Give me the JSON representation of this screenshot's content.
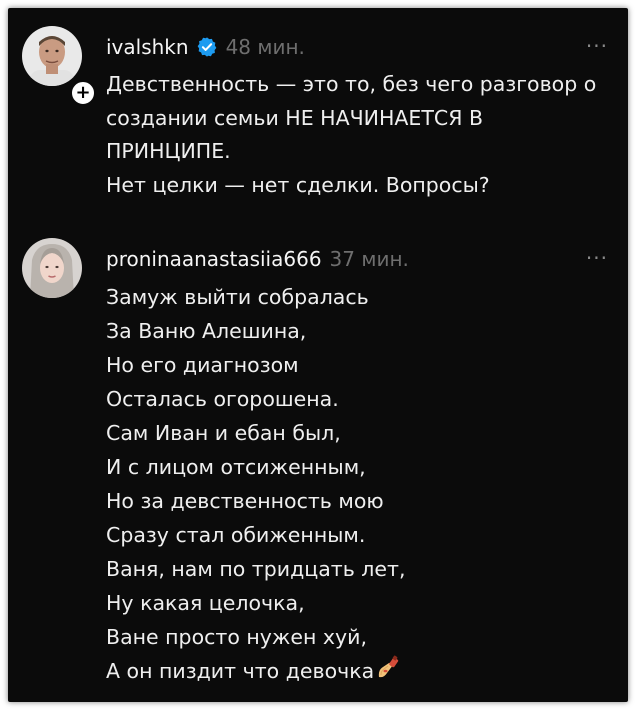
{
  "posts": [
    {
      "username": "ivalshkn",
      "verified": true,
      "time": "48 мин.",
      "more_label": "···",
      "follow_label": "+",
      "lines": [
        "Девственность — это то, без чего разговор о",
        "создании семьи НЕ НАЧИНАЕТСЯ В",
        "ПРИНЦИПЕ.",
        "Нет целки — нет сделки. Вопросы?"
      ]
    },
    {
      "username": "proninaanastasiia666",
      "verified": false,
      "time": "37 мин.",
      "more_label": "···",
      "lines": [
        "Замуж выйти собралась",
        "За Ваню Алешина,",
        "Но его диагнозом",
        "Осталась огорошена.",
        "Сам Иван и ебан был,",
        "И с лицом отсиженным,",
        "Но за девственность мою",
        "Сразу стал обиженным.",
        "Ваня, нам по тридцать лет,",
        "Ну какая целочка,",
        "Ване просто нужен хуй,",
        "А он пиздит что девочка"
      ],
      "trailing_icon": "nail-polish-icon"
    }
  ],
  "colors": {
    "background": "#0b0b0b",
    "text": "#efefef",
    "muted": "#6e6e6e",
    "verified": "#1d9bf0"
  }
}
